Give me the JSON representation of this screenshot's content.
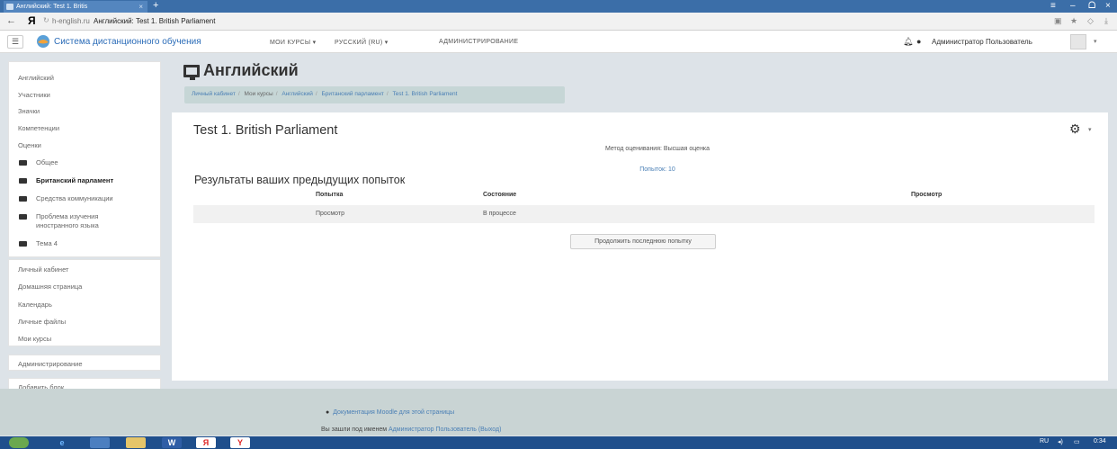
{
  "browser": {
    "tab_title": "Английский: Test 1. Britis",
    "tab_close": "×",
    "new_tab": "+",
    "window_controls": [
      "≡",
      "–",
      "ᗝ",
      "×"
    ],
    "back": "←",
    "brand": "Я",
    "domain": "h-english.ru",
    "page_title": "Английский: Test 1. British Parliament"
  },
  "navbar": {
    "site_name": "Система дистанционного обучения",
    "items": [
      "МОИ КУРСЫ ▾",
      "РУССКИЙ (RU) ▾",
      "АДМИНИСТРИРОВАНИЕ"
    ],
    "user": "Администратор Пользователь"
  },
  "sidebar": {
    "course_items": [
      "Английский",
      "Участники",
      "Значки",
      "Компетенции",
      "Оценки"
    ],
    "sections": [
      {
        "label": "Общее",
        "bold": false
      },
      {
        "label": "Британский парламент",
        "bold": true
      },
      {
        "label": "Средства коммуникации",
        "bold": false
      },
      {
        "label": "Проблема изучения",
        "line2": "иностранного языка",
        "bold": false
      },
      {
        "label": "Тема 4",
        "bold": false
      }
    ],
    "site_items": [
      "Личный кабинет",
      "Домашняя страница",
      "Календарь",
      "Личные файлы",
      "Мои курсы"
    ],
    "admin": "Администрирование",
    "add_block": "Добавить блок"
  },
  "main": {
    "course_title": "Английский",
    "breadcrumb": [
      "Личный кабинет",
      "Мои курсы",
      "Английский",
      "Британский парламент",
      "Test 1. British Parliament"
    ],
    "quiz_title": "Test 1. British Parliament",
    "grading_method": "Метод оценивания: Высшая оценка",
    "attempts_allowed": "Попыток: 10",
    "results_heading": "Результаты ваших предыдущих попыток",
    "table": {
      "headers": [
        "Попытка",
        "Состояние",
        "Просмотр"
      ],
      "rows": [
        [
          "Просмотр",
          "В процессе",
          ""
        ]
      ]
    },
    "continue_button": "Продолжить последнюю попытку"
  },
  "footer": {
    "doc_link": "Документация Moodle для этой страницы",
    "login_prefix": "Вы зашли под именем ",
    "login_user": "Администратор Пользователь",
    "logout": "(Выход)"
  },
  "taskbar": {
    "lang": "RU",
    "time": "0:34"
  }
}
